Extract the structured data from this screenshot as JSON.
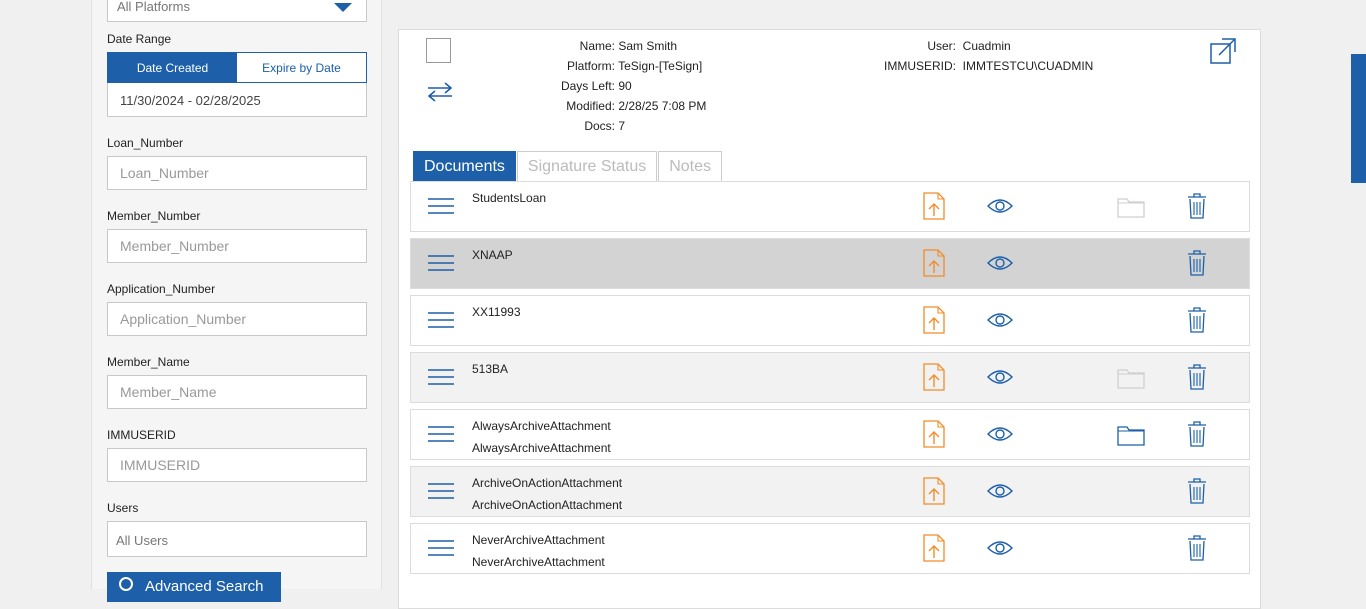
{
  "filters": {
    "platform_value": "All Platforms",
    "date_range_label": "Date Range",
    "date_created_label": "Date Created",
    "expire_by_date_label": "Expire by Date",
    "date_range_value": "11/30/2024 - 02/28/2025",
    "loan_number_label": "Loan_Number",
    "loan_number_placeholder": "Loan_Number",
    "member_number_label": "Member_Number",
    "member_number_placeholder": "Member_Number",
    "application_number_label": "Application_Number",
    "application_number_placeholder": "Application_Number",
    "member_name_label": "Member_Name",
    "member_name_placeholder": "Member_Name",
    "immuserid_label": "IMMUSERID",
    "immuserid_placeholder": "IMMUSERID",
    "users_label": "Users",
    "users_value": "All Users",
    "advanced_search_label": "Advanced Search"
  },
  "package": {
    "name_key": "Name:",
    "name_value": "Sam Smith",
    "platform_key": "Platform:",
    "platform_value": "TeSign-[TeSign]",
    "days_left_key": "Days Left:",
    "days_left_value": "90",
    "modified_key": "Modified:",
    "modified_value": "2/28/25 7:08 PM",
    "docs_key": "Docs:",
    "docs_value": "7",
    "user_key": "User:",
    "user_value": "Cuadmin",
    "immuserid_key": "IMMUSERID:",
    "immuserid_value": "IMMTESTCU\\CUADMIN"
  },
  "tabs": {
    "documents": "Documents",
    "signature_status": "Signature Status",
    "notes": "Notes"
  },
  "documents": [
    {
      "name": "StudentsLoan",
      "subname": "",
      "folder": "light"
    },
    {
      "name": "XNAAP",
      "subname": "",
      "folder": "none"
    },
    {
      "name": "XX11993",
      "subname": "",
      "folder": "none"
    },
    {
      "name": "513BA",
      "subname": "",
      "folder": "light"
    },
    {
      "name": "AlwaysArchiveAttachment",
      "subname": "AlwaysArchiveAttachment",
      "folder": "blue"
    },
    {
      "name": "ArchiveOnActionAttachment",
      "subname": "ArchiveOnActionAttachment",
      "folder": "none"
    },
    {
      "name": "NeverArchiveAttachment",
      "subname": "NeverArchiveAttachment",
      "folder": "none"
    }
  ],
  "colors": {
    "primary": "#1d5fa8",
    "upload_icon": "#f28c28",
    "selected_row": "#d3d3d3"
  }
}
